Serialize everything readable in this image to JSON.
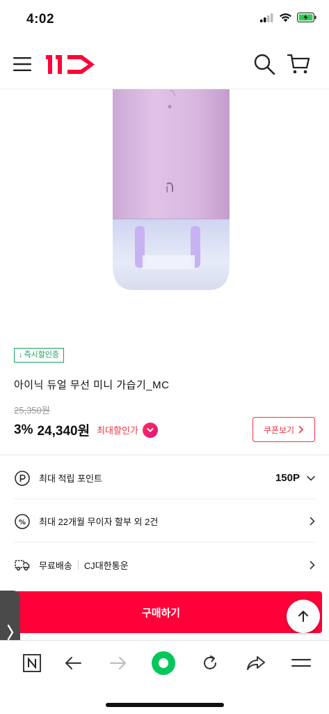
{
  "status": {
    "time": "4:02"
  },
  "header": {
    "logo_text": "11"
  },
  "product": {
    "badge": "즉시할인증",
    "title": "아이닉 듀얼 무선 미니 가습기_MC",
    "original_price": "25,350원",
    "discount_rate": "3%",
    "sale_price": "24,340원",
    "max_discount_label": "최대할인가",
    "coupon_label": "쿠폰보기"
  },
  "info_rows": [
    {
      "label": "최대 적립 포인트",
      "value": "150P",
      "icon": "point-icon"
    },
    {
      "label": "최대 22개월 무이자 할부 외 2건",
      "value": "",
      "icon": "percent-icon"
    },
    {
      "label_main": "무료배송",
      "label_sub": "CJ대한통운",
      "icon": "truck-icon"
    }
  ],
  "buy": {
    "label": "구매하기"
  },
  "colors": {
    "brand": "#ff0038",
    "accent_red": "#f43142",
    "badge_green": "#1aa35f",
    "device_lavender": "#d9b8e0"
  },
  "icons": [
    "menu-icon",
    "search-icon",
    "cart-icon",
    "back-icon",
    "forward-icon",
    "home-icon",
    "refresh-icon",
    "share-icon",
    "more-icon",
    "naver-icon"
  ]
}
